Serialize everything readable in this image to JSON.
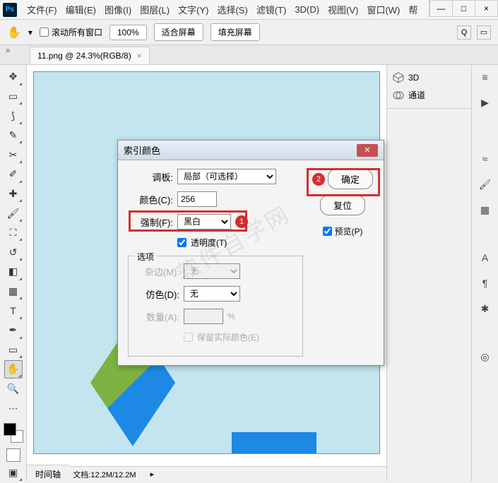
{
  "window_controls": {
    "minimize": "—",
    "maximize": "□",
    "close": "×"
  },
  "menubar": {
    "items": [
      "文件(F)",
      "编辑(E)",
      "图像(I)",
      "图层(L)",
      "文字(Y)",
      "选择(S)",
      "滤镜(T)",
      "3D(D)",
      "视图(V)",
      "窗口(W)",
      "帮"
    ]
  },
  "options": {
    "scroll_all": "滚动所有窗口",
    "zoom": "100%",
    "fit_screen": "适合屏幕",
    "fill_screen": "填充屏幕"
  },
  "tab": {
    "title": "11.png @ 24.3%(RGB/8)",
    "close": "×"
  },
  "status": {
    "zoom": "24.35%",
    "doc": "文档:12.2M/12.2M"
  },
  "timeline": {
    "label": "时间轴"
  },
  "panels": {
    "3d": "3D",
    "channels": "通道"
  },
  "dialog": {
    "title": "索引颜色",
    "palette_label": "调板:",
    "palette_value": "局部（可选择）",
    "colors_label": "颜色(C):",
    "colors_value": "256",
    "forced_label": "强制(F):",
    "forced_value": "黑白",
    "transparency": "透明度(T)",
    "options_label": "选项",
    "matte_label": "杂边(M):",
    "matte_value": "无",
    "dither_label": "仿色(D):",
    "dither_value": "无",
    "amount_label": "数量(A):",
    "amount_unit": "%",
    "preserve": "保留实际颜色(E)",
    "ok": "确定",
    "reset": "复位",
    "preview": "预览(P)"
  },
  "annotations": {
    "badge1": "1",
    "badge2": "2"
  }
}
